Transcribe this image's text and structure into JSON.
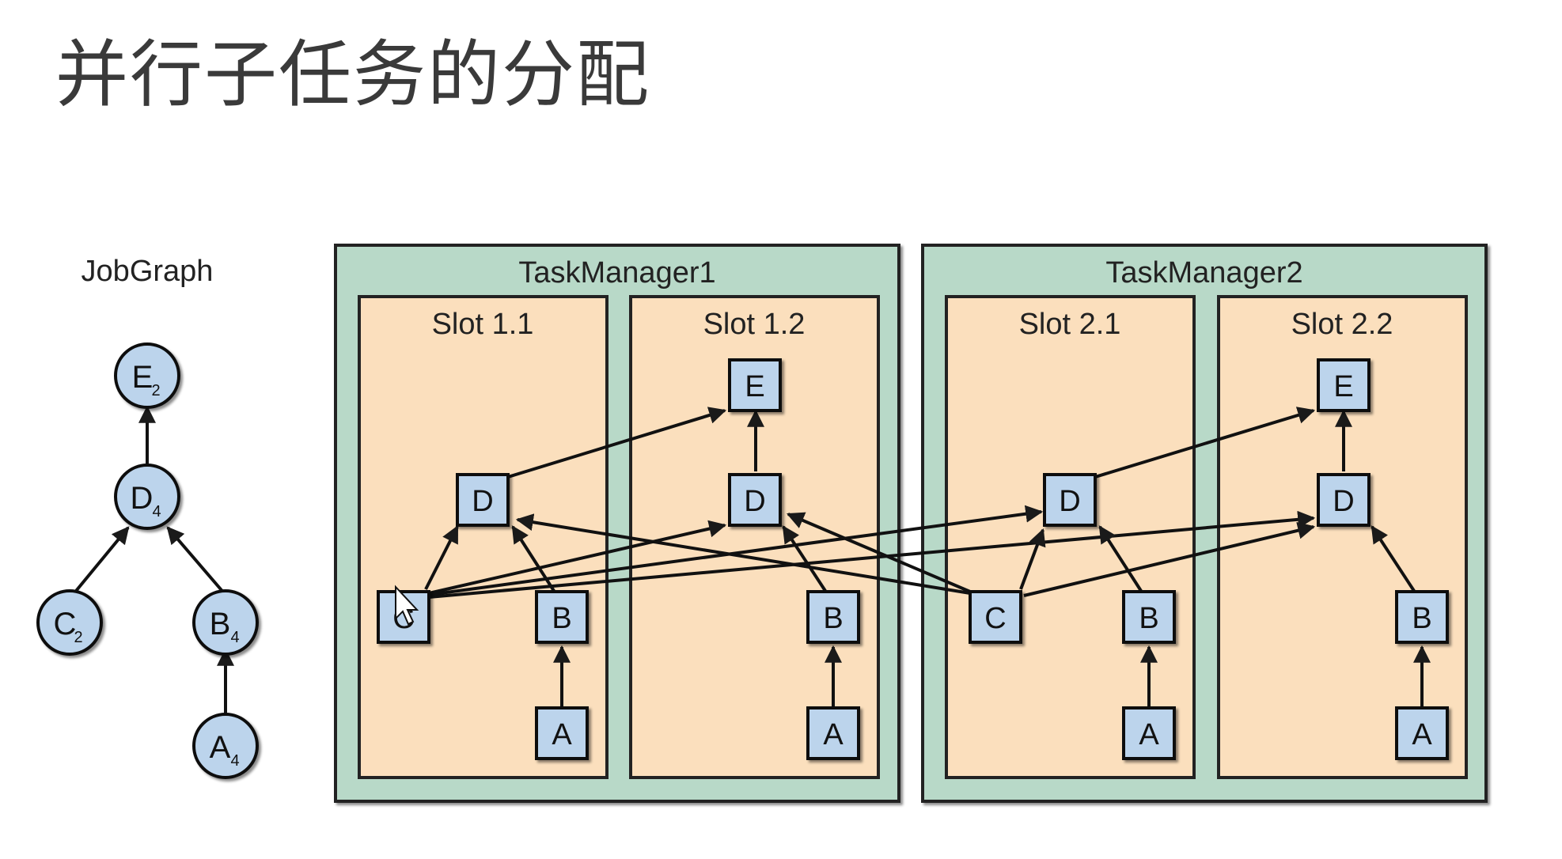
{
  "title": "并行子任务的分配",
  "jobgraph": {
    "label": "JobGraph",
    "nodes": [
      {
        "id": "E",
        "sub": "2"
      },
      {
        "id": "D",
        "sub": "4"
      },
      {
        "id": "C",
        "sub": "2"
      },
      {
        "id": "B",
        "sub": "4"
      },
      {
        "id": "A",
        "sub": "4"
      }
    ]
  },
  "task_managers": [
    {
      "label": "TaskManager1",
      "slots": [
        {
          "label": "Slot 1.1",
          "tasks": [
            "D",
            "C",
            "B",
            "A"
          ]
        },
        {
          "label": "Slot 1.2",
          "tasks": [
            "E",
            "D",
            "B",
            "A"
          ]
        }
      ]
    },
    {
      "label": "TaskManager2",
      "slots": [
        {
          "label": "Slot 2.1",
          "tasks": [
            "D",
            "C",
            "B",
            "A"
          ]
        },
        {
          "label": "Slot 2.2",
          "tasks": [
            "E",
            "D",
            "B",
            "A"
          ]
        }
      ]
    }
  ],
  "colors": {
    "manager_fill": "#b8d9c8",
    "slot_fill": "#fbdfbd",
    "task_fill": "#bcd4ec",
    "node_fill": "#bcd4ec",
    "stroke": "#1a1a1a"
  }
}
